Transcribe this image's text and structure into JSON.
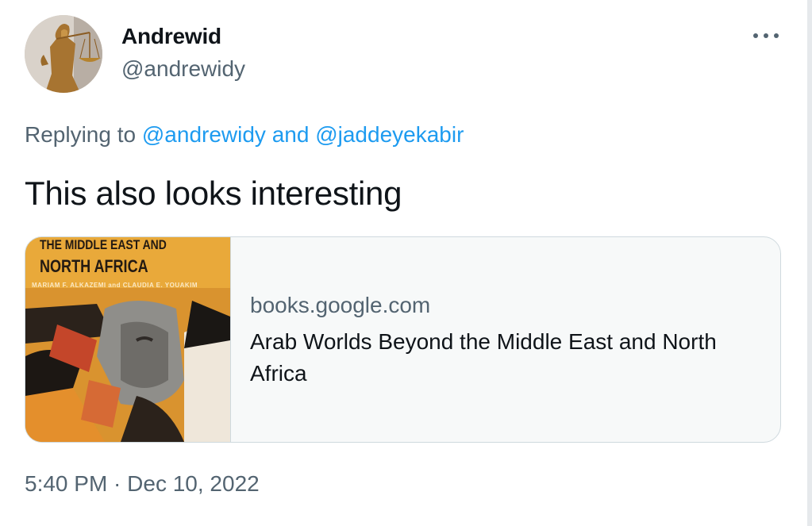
{
  "tweet": {
    "author": {
      "display_name": "Andrewid",
      "handle": "@andrewidy",
      "avatar_icon": "lady-justice-statue-avatar"
    },
    "more_icon": "more-options-icon",
    "reply_context": {
      "prefix": "Replying to",
      "mention_1": "@andrewidy",
      "conjunction": "and",
      "mention_2": "@jaddeyekabir"
    },
    "text": "This also looks interesting",
    "link_card": {
      "image": {
        "cover_title_line1": "THE MIDDLE EAST AND",
        "cover_title_line2": "NORTH AFRICA",
        "cover_editors": "MARIAM F. ALKAZEMI and CLAUDIA E. YOUAKIM"
      },
      "domain": "books.google.com",
      "title": "Arab Worlds Beyond the Middle East and North Africa"
    },
    "timestamp": "5:40 PM · Dec 10, 2022"
  },
  "colors": {
    "text_primary": "#0f1419",
    "text_secondary": "#536471",
    "link_blue": "#1d9bf0",
    "card_border": "#cfd9de",
    "card_background": "#f7f9f9"
  }
}
